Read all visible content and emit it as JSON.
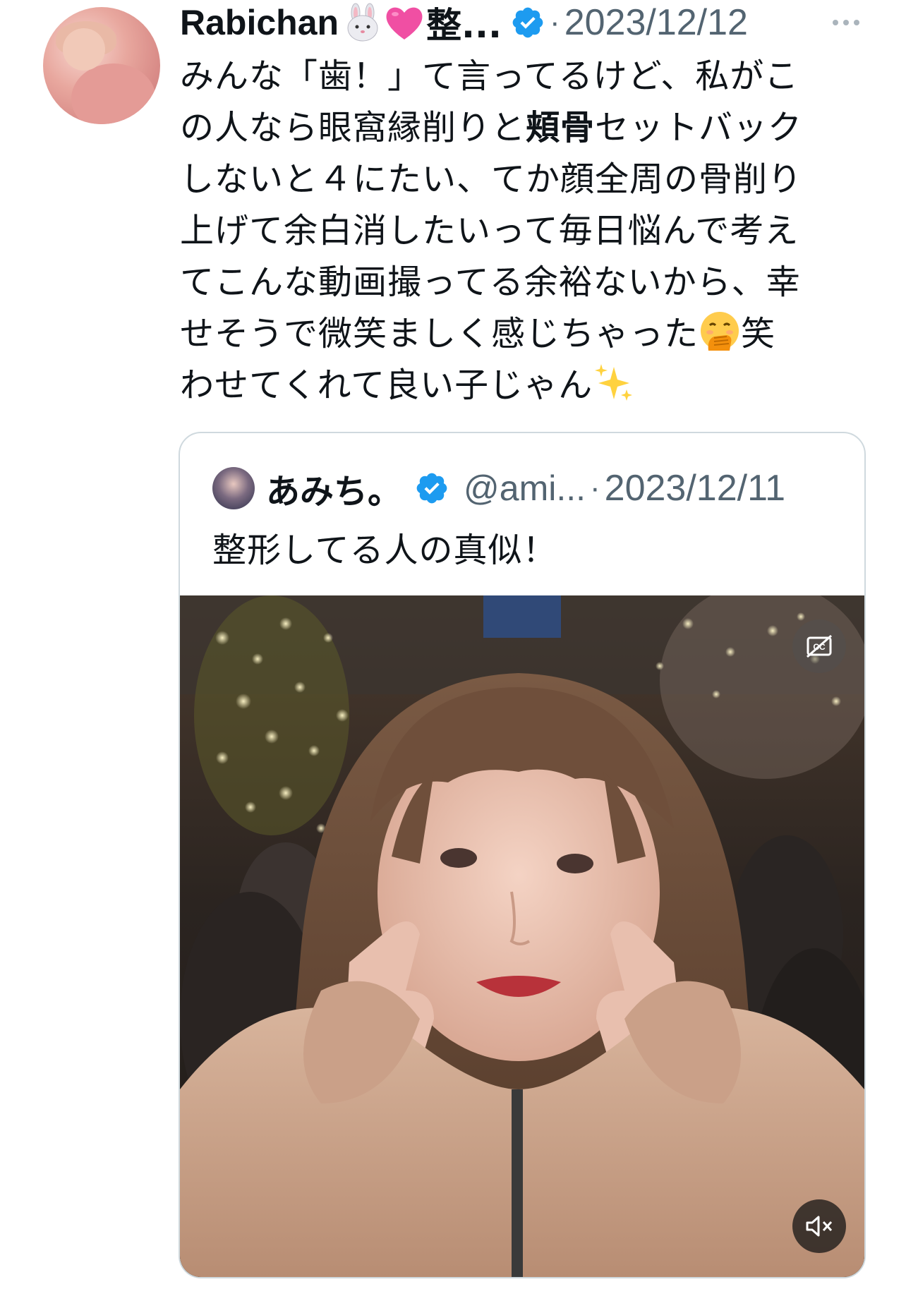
{
  "tweet": {
    "display_name": "Rabichan",
    "name_emojis": [
      "rabbit-face-emoji",
      "pink-heart-emoji"
    ],
    "name_tail": "整...",
    "separator": "·",
    "timestamp": "2023/12/12",
    "more_icon": "more-dots-icon",
    "body_lines": [
      {
        "pre": "みんな「歯！」て言ってるけど、私がこ",
        "bold": "",
        "post": ""
      },
      {
        "pre": "の人なら眼窩縁削りと",
        "bold": "頬骨",
        "post": "セットバック"
      },
      {
        "pre": "しないと４にたい、てか顔全周の骨削り",
        "bold": "",
        "post": ""
      },
      {
        "pre": "上げて余白消したいって毎日悩んで考え",
        "bold": "",
        "post": ""
      },
      {
        "pre": "てこんな動画撮ってる余裕ないから、幸",
        "bold": "",
        "post": ""
      },
      {
        "pre": "せそうで微笑ましく感じちゃった",
        "bold": "",
        "post": "笑"
      },
      {
        "pre": "わせてくれて良い子じゃん",
        "bold": "",
        "post": ""
      }
    ],
    "inline_emojis": [
      "hand-over-mouth-emoji",
      "sparkles-emoji"
    ]
  },
  "quote": {
    "display_name": "あみち。",
    "handle": "@ami...",
    "separator": "·",
    "timestamp": "2023/12/11",
    "text": "整形してる人の真似！",
    "video": {
      "cc_icon": "closed-captions-off-icon",
      "mute_icon": "muted-speaker-icon"
    }
  },
  "colors": {
    "verified_blue": "#1d9bf0",
    "secondary_text": "#536471",
    "border": "#cfd9de"
  }
}
